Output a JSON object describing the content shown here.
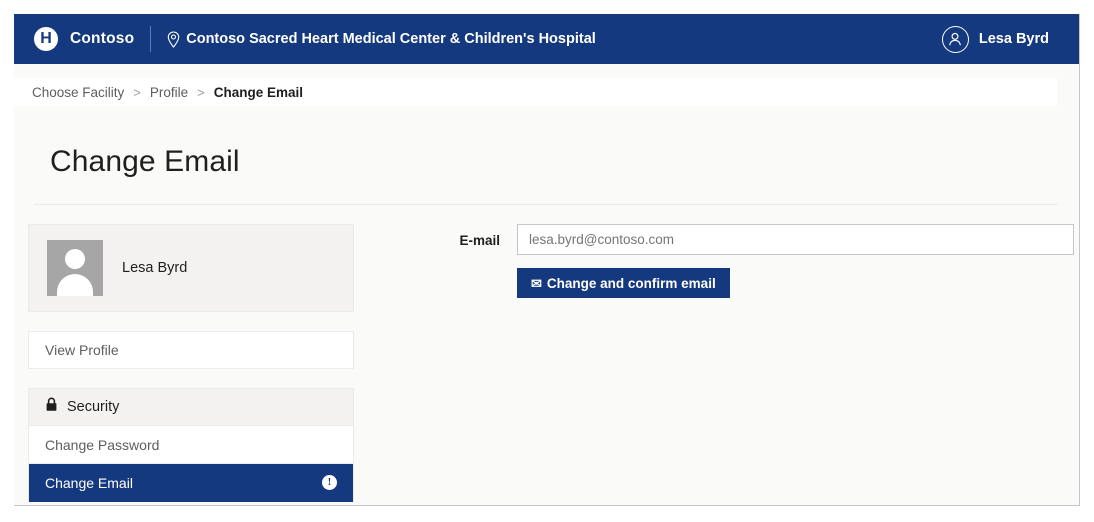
{
  "header": {
    "logo_letter": "H",
    "brand": "Contoso",
    "facility": "Contoso Sacred Heart Medical Center & Children's Hospital",
    "user_name": "Lesa Byrd",
    "brand_color": "#15397f"
  },
  "breadcrumb": {
    "items": [
      {
        "label": "Choose Facility",
        "current": false
      },
      {
        "label": "Profile",
        "current": false
      },
      {
        "label": "Change Email",
        "current": true
      }
    ],
    "separator": ">"
  },
  "page": {
    "title": "Change Email"
  },
  "sidebar": {
    "profile": {
      "name": "Lesa Byrd"
    },
    "view_profile": "View Profile",
    "security_group": {
      "header": "Security",
      "items": [
        {
          "label": "Change Password",
          "active": false,
          "badge": ""
        },
        {
          "label": "Change Email",
          "active": true,
          "badge": "!"
        }
      ]
    }
  },
  "form": {
    "email_label": "E-mail",
    "email_value": "",
    "email_placeholder": "lesa.byrd@contoso.com",
    "submit_label": "Change and confirm email",
    "submit_icon": "envelope-icon"
  }
}
